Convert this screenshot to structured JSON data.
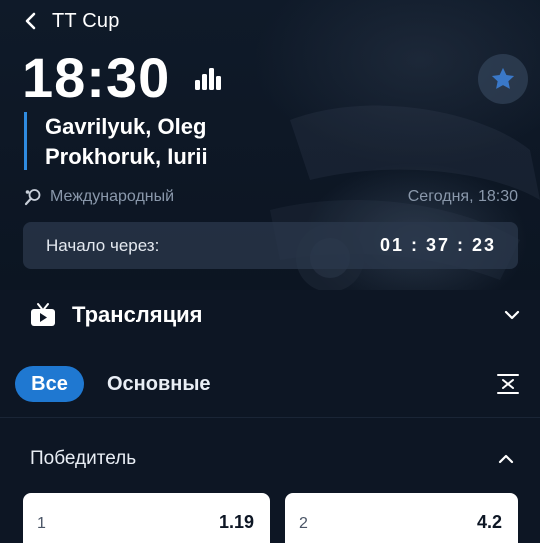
{
  "header": {
    "title": "TT Cup"
  },
  "match": {
    "time": "18:30",
    "player1": "Gavrilyuk, Oleg",
    "player2": "Prokhoruk, Iurii",
    "tournament": "Международный",
    "date": "Сегодня, 18:30"
  },
  "countdown": {
    "label": "Начало через:",
    "value": "01 : 37 : 23"
  },
  "broadcast": {
    "label": "Трансляция"
  },
  "filters": {
    "all_label": "Все",
    "main_label": "Основные"
  },
  "market": {
    "title": "Победитель",
    "odds": [
      {
        "label": "1",
        "value": "1.19"
      },
      {
        "label": "2",
        "value": "4.2"
      }
    ]
  },
  "colors": {
    "background": "#0d1624",
    "accent": "#1f78d1",
    "player_bar": "#2f8be0",
    "muted_text": "#8a98ab"
  }
}
